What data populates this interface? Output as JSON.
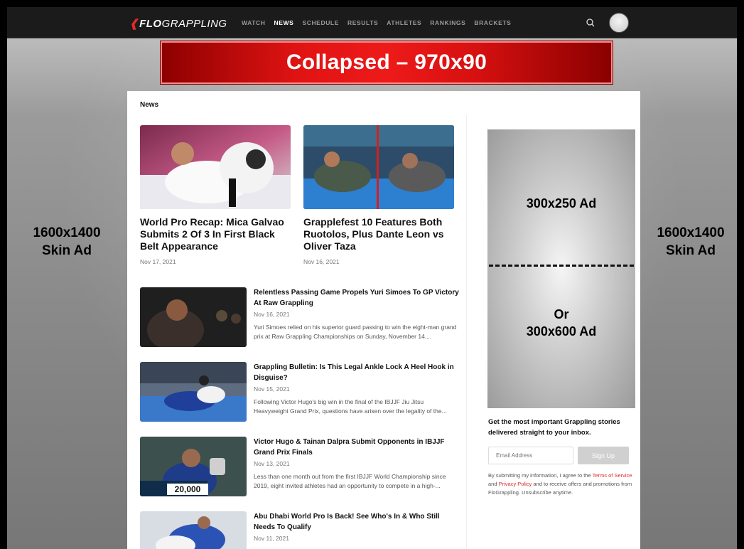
{
  "nav": {
    "logo_flo": "FLO",
    "logo_sport": "GRAPPLING",
    "links": [
      "WATCH",
      "NEWS",
      "SCHEDULE",
      "RESULTS",
      "ATHLETES",
      "RANKINGS",
      "BRACKETS"
    ],
    "active": "NEWS"
  },
  "banner_ad": {
    "label": "Collapsed – 970x90"
  },
  "skin_ad": {
    "line1": "1600x1400",
    "line2": "Skin Ad"
  },
  "page": {
    "section_title": "News"
  },
  "featured": [
    {
      "title": "World Pro Recap: Mica Galvao Submits 2 Of 3 In First Black Belt Appearance",
      "date": "Nov 17, 2021"
    },
    {
      "title": "Grapplefest 10 Features Both Ruotolos, Plus Dante Leon vs Oliver Taza",
      "date": "Nov 16, 2021"
    }
  ],
  "articles": [
    {
      "title": "Relentless Passing Game Propels Yuri Simoes To GP Victory At Raw Grappling",
      "date": "Nov 16, 2021",
      "desc": "Yuri Simoes relied on his superior guard passing to win the eight-man grand prix at Raw Grappling Championships on Sunday, November 14...."
    },
    {
      "title": "Grappling Bulletin: Is This Legal Ankle Lock A Heel Hook in Disguise?",
      "date": "Nov 15, 2021",
      "desc": "Following Victor Hugo's big win in the final of the IBJJF Jiu Jitsu Heavyweight Grand Prix, questions have arisen over the legality of the..."
    },
    {
      "title": "Victor Hugo & Tainan Dalpra Submit Opponents in IBJJF Grand Prix Finals",
      "date": "Nov 13, 2021",
      "desc": "Less than one month out from the first IBJJF World Championship since 2019, eight invited athletes had an opportunity to compete in a high-..."
    },
    {
      "title": "Abu Dhabi World Pro Is Back! See Who's In & Who Still Needs To Qualify",
      "date": "Nov 11, 2021",
      "desc": ""
    }
  ],
  "side_ad": {
    "label1": "300x250 Ad",
    "label2": "Or",
    "label3": "300x600 Ad"
  },
  "newsletter": {
    "title": "Get the most important Grappling stories delivered straight to your inbox.",
    "email_placeholder": "Email Address",
    "signup_label": "Sign Up",
    "disclaimer_1": "By submitting my information, I agree to the ",
    "terms": "Terms of Service",
    "disclaimer_2": " and ",
    "privacy": "Privacy Policy",
    "disclaimer_3": " and to receive offers and promotions from FloGrappling. Unsubscribe anytime."
  },
  "thumb_overlay": {
    "number": "20,000"
  },
  "colors": {
    "brand_red": "#e12a2a",
    "nav_bg": "#1b1b1b"
  }
}
